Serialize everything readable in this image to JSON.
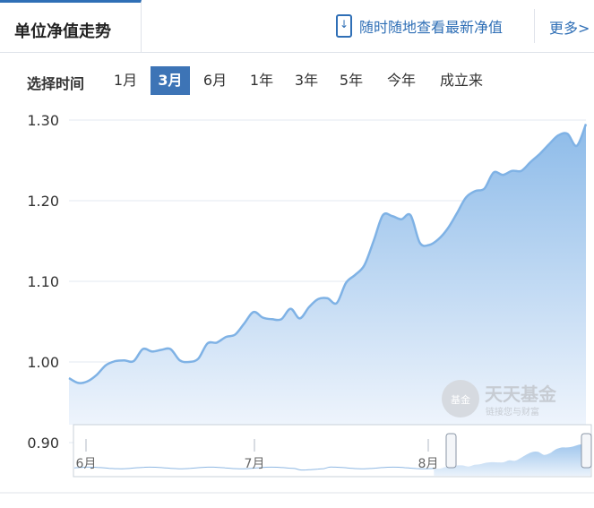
{
  "header": {
    "tab_title": "单位净值走势",
    "mobile_link": "随时随地查看最新净值",
    "more": "更多>"
  },
  "range": {
    "label": "选择时间",
    "options": [
      "1月",
      "3月",
      "6月",
      "1年",
      "3年",
      "5年",
      "今年",
      "成立来"
    ],
    "selected": "3月"
  },
  "watermark": {
    "title": "天天基金",
    "badge": "基金",
    "subtitle": "链接您与财富"
  },
  "colors": {
    "line": "#7fb2e5",
    "fill_top": "#8dbbe9",
    "fill_bottom": "#eef4fc",
    "active": "#3d74b6"
  },
  "chart_data": {
    "type": "area",
    "y_ticks": [
      "0.90",
      "1.00",
      "1.10",
      "1.20",
      "1.30"
    ],
    "ylim": [
      0.9,
      1.3
    ],
    "grid": true,
    "navigator_labels": [
      "6月",
      "7月",
      "8月"
    ],
    "series": [
      {
        "values": [
          0.98,
          0.974,
          0.976,
          0.984,
          0.996,
          1.001,
          1.002,
          1.001,
          1.016,
          1.013,
          1.015,
          1.016,
          1.002,
          1.0,
          1.004,
          1.023,
          1.024,
          1.031,
          1.034,
          1.048,
          1.062,
          1.055,
          1.053,
          1.053,
          1.066,
          1.054,
          1.068,
          1.078,
          1.079,
          1.073,
          1.098,
          1.108,
          1.12,
          1.15,
          1.182,
          1.181,
          1.177,
          1.182,
          1.148,
          1.145,
          1.152,
          1.165,
          1.184,
          1.204,
          1.212,
          1.215,
          1.235,
          1.232,
          1.237,
          1.237,
          1.248,
          1.258,
          1.27,
          1.281,
          1.283,
          1.268,
          1.295
        ]
      }
    ]
  }
}
